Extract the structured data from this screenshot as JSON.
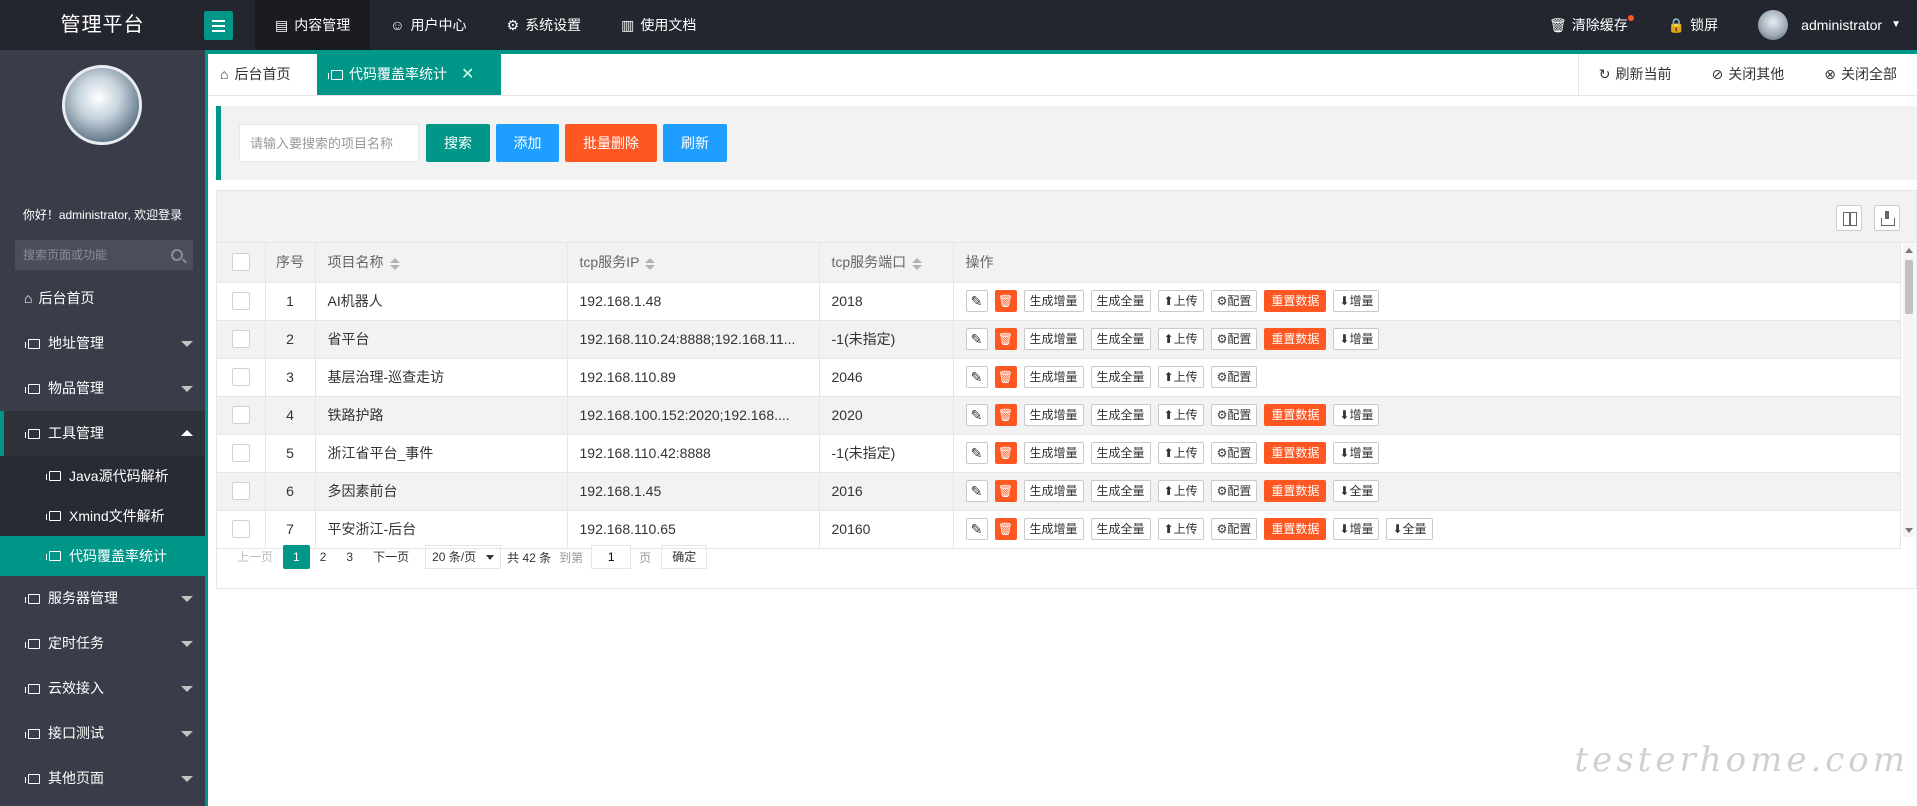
{
  "app": {
    "title": "管理平台",
    "accent": "#009688",
    "danger": "#ff5722",
    "blue": "#1e9fff"
  },
  "topnav": [
    {
      "label": "内容管理",
      "icon": "doc-icon",
      "active": true
    },
    {
      "label": "用户中心",
      "icon": "users-icon",
      "active": false
    },
    {
      "label": "系统设置",
      "icon": "gear-icon",
      "active": false
    },
    {
      "label": "使用文档",
      "icon": "book-icon",
      "active": false
    }
  ],
  "topright": {
    "clear_cache": "清除缓存",
    "lock": "锁屏",
    "username": "administrator"
  },
  "sidebar": {
    "welcome": "你好！administrator, 欢迎登录",
    "search_placeholder": "搜索页面或功能",
    "items": [
      {
        "label": "后台首页",
        "icon": "home-icon",
        "arrow": false
      },
      {
        "label": "地址管理",
        "icon": "module-icon",
        "arrow": true
      },
      {
        "label": "物品管理",
        "icon": "module-icon",
        "arrow": true
      },
      {
        "label": "工具管理",
        "icon": "module-icon",
        "arrow": true,
        "open": true,
        "children": [
          {
            "label": "Java源代码解析",
            "active": false
          },
          {
            "label": "Xmind文件解析",
            "active": false
          },
          {
            "label": "代码覆盖率统计",
            "active": true
          }
        ]
      },
      {
        "label": "服务器管理",
        "icon": "module-icon",
        "arrow": true
      },
      {
        "label": "定时任务",
        "icon": "module-icon",
        "arrow": true
      },
      {
        "label": "云效接入",
        "icon": "module-icon",
        "arrow": true
      },
      {
        "label": "接口测试",
        "icon": "module-icon",
        "arrow": true
      },
      {
        "label": "其他页面",
        "icon": "module-icon",
        "arrow": true
      }
    ]
  },
  "tabs": {
    "home": "后台首页",
    "current": "代码覆盖率统计",
    "refresh": "刷新当前",
    "close_others": "关闭其他",
    "close_all": "关闭全部"
  },
  "toolbar": {
    "search_placeholder": "请输入要搜索的项目名称",
    "search": "搜索",
    "add": "添加",
    "batch_delete": "批量删除",
    "refresh": "刷新"
  },
  "table": {
    "headers": {
      "index": "序号",
      "name": "项目名称",
      "ip": "tcp服务IP",
      "port": "tcp服务端口",
      "ops": "操作"
    },
    "op_labels": {
      "gen_inc": "生成增量",
      "gen_full": "生成全量",
      "upload": "上传",
      "config": "配置",
      "reset": "重置数据",
      "inc": "增量",
      "full": "全量"
    },
    "rows": [
      {
        "index": "1",
        "name": "AI机器人",
        "ip": "192.168.1.48",
        "port": "2018",
        "ops": [
          "gen_inc",
          "gen_full",
          "upload",
          "config",
          "reset",
          "inc"
        ]
      },
      {
        "index": "2",
        "name": "省平台",
        "ip": "192.168.110.24:8888;192.168.11...",
        "port": "-1(未指定)",
        "ops": [
          "gen_inc",
          "gen_full",
          "upload",
          "config",
          "reset",
          "inc"
        ]
      },
      {
        "index": "3",
        "name": "基层治理-巡查走访",
        "ip": "192.168.110.89",
        "port": "2046",
        "ops": [
          "gen_inc",
          "gen_full",
          "upload",
          "config"
        ]
      },
      {
        "index": "4",
        "name": "铁路护路",
        "ip": "192.168.100.152:2020;192.168....",
        "port": "2020",
        "ops": [
          "gen_inc",
          "gen_full",
          "upload",
          "config",
          "reset",
          "inc"
        ]
      },
      {
        "index": "5",
        "name": "浙江省平台_事件",
        "ip": "192.168.110.42:8888",
        "port": "-1(未指定)",
        "ops": [
          "gen_inc",
          "gen_full",
          "upload",
          "config",
          "reset",
          "inc"
        ]
      },
      {
        "index": "6",
        "name": "多因素前台",
        "ip": "192.168.1.45",
        "port": "2016",
        "ops": [
          "gen_inc",
          "gen_full",
          "upload",
          "config",
          "reset",
          "full"
        ]
      },
      {
        "index": "7",
        "name": "平安浙江-后台",
        "ip": "192.168.110.65",
        "port": "20160",
        "ops": [
          "gen_inc",
          "gen_full",
          "upload",
          "config",
          "reset",
          "inc",
          "full"
        ]
      }
    ]
  },
  "pager": {
    "prev": "上一页",
    "pages": [
      "1",
      "2",
      "3"
    ],
    "current": "1",
    "next": "下一页",
    "page_size": "20 条/页",
    "total": "共 42 条",
    "goto": "到第",
    "goto_value": "1",
    "page_unit": "页",
    "confirm": "确定"
  },
  "watermark": "testerhome.com"
}
